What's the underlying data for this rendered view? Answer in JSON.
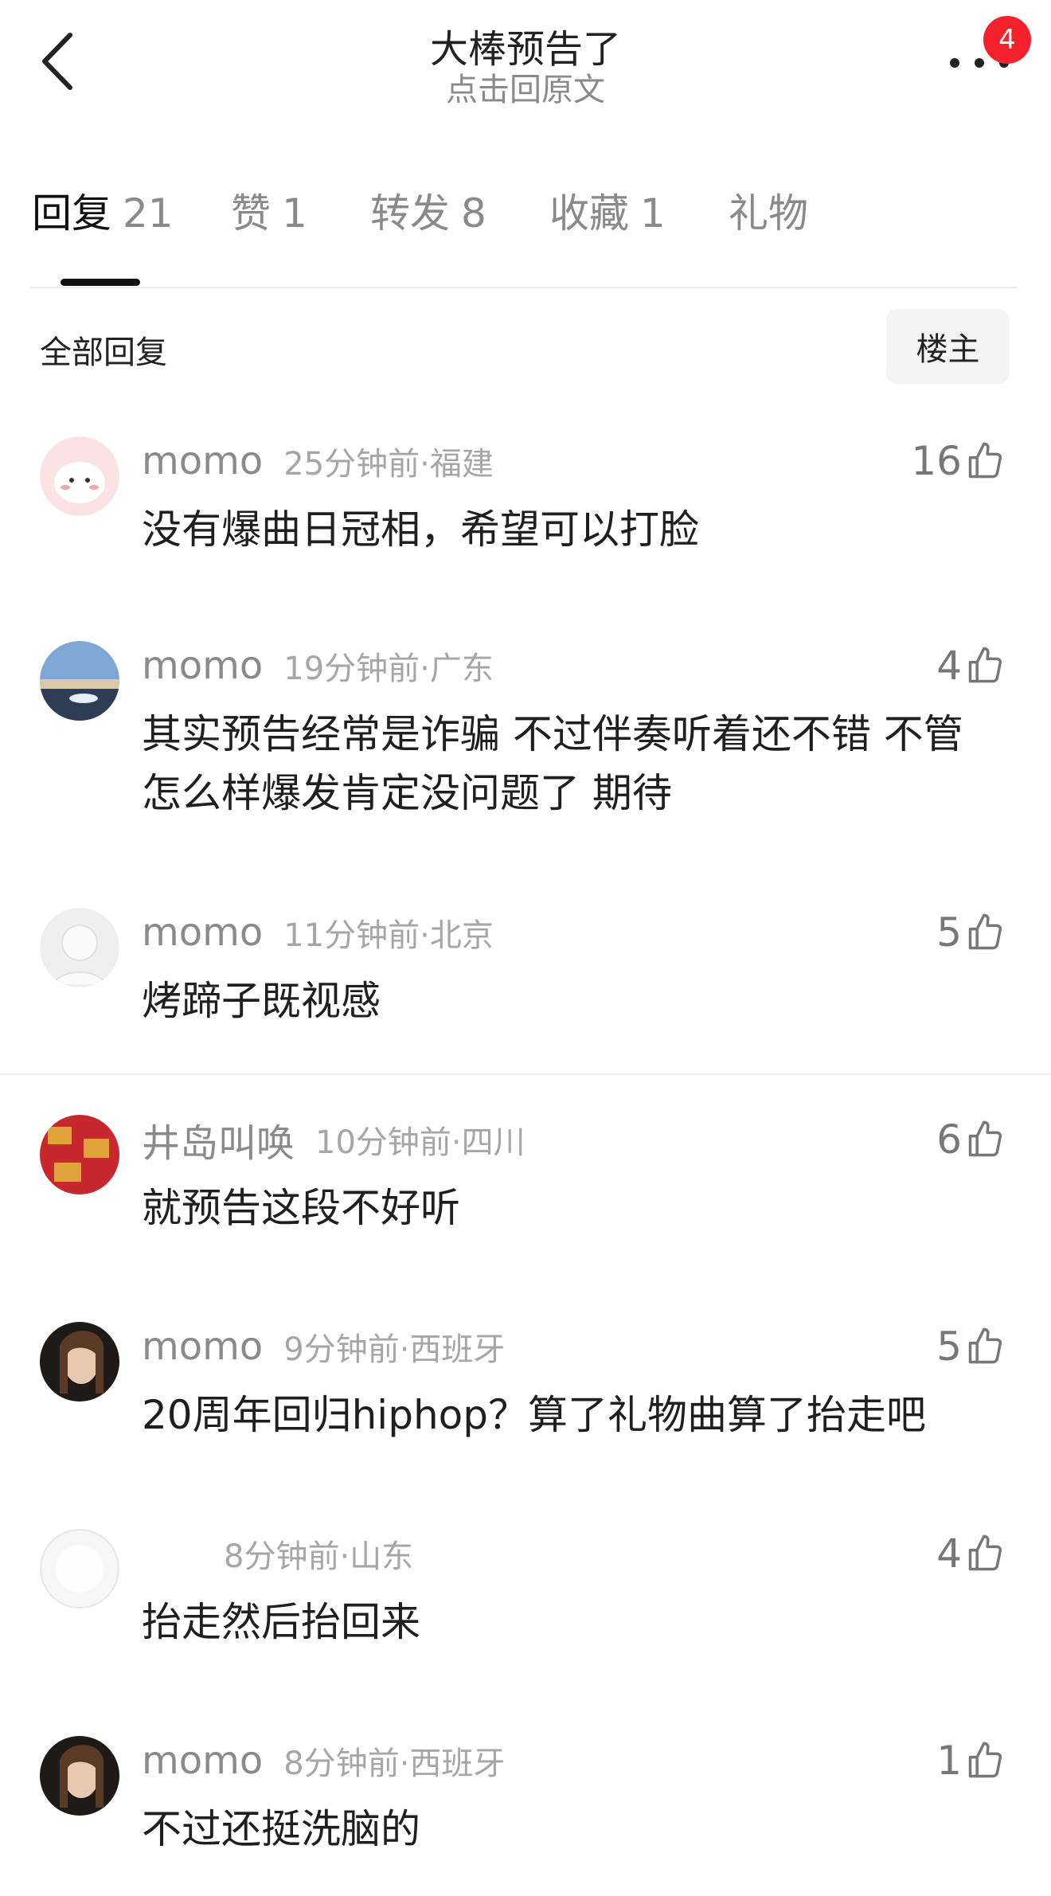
{
  "header": {
    "title": "大棒预告了",
    "subtitle": "点击回原文",
    "badge_count": "4",
    "back_icon": "chevron-left-icon",
    "more_icon": "ellipsis-icon"
  },
  "tabs": [
    {
      "label": "回复",
      "count": "21",
      "active": true
    },
    {
      "label": "赞",
      "count": "1"
    },
    {
      "label": "转发",
      "count": "8"
    },
    {
      "label": "收藏",
      "count": "1"
    },
    {
      "label": "礼物",
      "count": ""
    }
  ],
  "section": {
    "title": "全部回复",
    "op_button": "楼主"
  },
  "comments": [
    {
      "user": "momo",
      "time": "25分钟前·福建",
      "likes": "16",
      "text": "没有爆曲日冠相，希望可以打脸"
    },
    {
      "user": "momo",
      "time": "19分钟前·广东",
      "likes": "4",
      "text": "其实预告经常是诈骗 不过伴奏听着还不错 不管怎么样爆发肯定没问题了 期待"
    },
    {
      "user": "momo",
      "time": "11分钟前·北京",
      "likes": "5",
      "text": "烤蹄子既视感"
    },
    {
      "user": "井岛叫唤",
      "time": "10分钟前·四川",
      "likes": "6",
      "text": "就预告这段不好听"
    },
    {
      "user": "momo",
      "time": "9分钟前·西班牙",
      "likes": "5",
      "text": "20周年回归hiphop？算了礼物曲算了抬走吧"
    },
    {
      "user": "",
      "time": "8分钟前·山东",
      "likes": "4",
      "text": "抬走然后抬回来"
    },
    {
      "user": "momo",
      "time": "8分钟前·西班牙",
      "likes": "1",
      "text": "不过还挺洗脑的"
    }
  ],
  "colors": {
    "accent": "#111111",
    "badge": "#f5222d",
    "muted": "#8a8a8a"
  }
}
